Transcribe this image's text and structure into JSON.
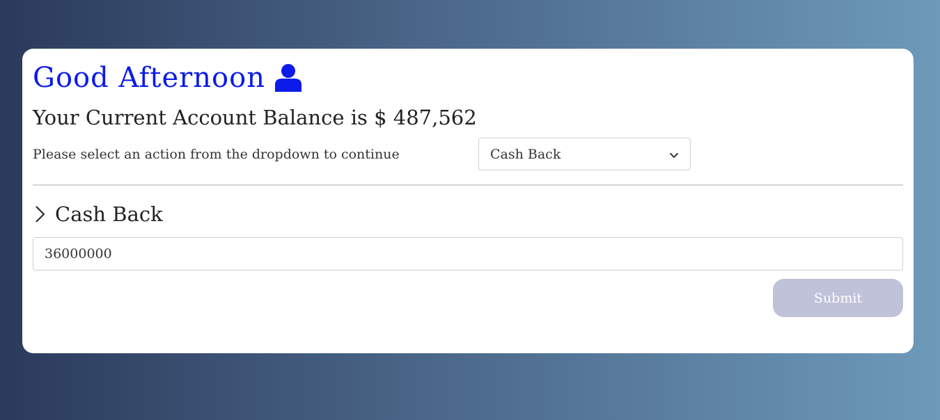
{
  "header": {
    "greeting": "Good Afternoon",
    "user_icon": "user-icon"
  },
  "balance": {
    "text": "Your Current Account Balance is $ 487,562"
  },
  "action": {
    "prompt": "Please select an action from the dropdown to continue",
    "selected": "Cash Back",
    "dropdown_icon": "chevron-down-icon"
  },
  "section": {
    "title": "Cash Back",
    "icon": "chevron-right-icon"
  },
  "form": {
    "amount_value": "36000000",
    "submit_label": "Submit"
  },
  "colors": {
    "accent": "#0b1bea",
    "submit_disabled": "#bfc2d9"
  }
}
